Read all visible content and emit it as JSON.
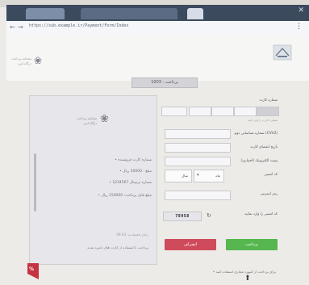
{
  "browser": {
    "url": "https://sub.example.ir/Payment/Form/Index"
  },
  "header": {
    "brand_line1": "سامانه پرداخت",
    "brand_line2": "درگاه امن"
  },
  "title": "پرداخت - 1003",
  "left_panel": {
    "logo_line1": "سامانه پرداخت",
    "logo_line2": "درگاه امن",
    "lines": [
      "• شماره کارت فروشنده",
      "• مبلغ : 50000 ریال",
      "• شماره ترمینال 1234567",
      "• مبلغ قابل پرداخت: 150000 ریال"
    ],
    "footer": "زمان باقیمانده: 09:43",
    "checkbox_label": "پرداخت با استفاده از کارت های ذخیره شده"
  },
  "form": {
    "card_label": "شماره کارت",
    "card_hint": "شماره کارت را وارد کنید",
    "cvv2_label": "شماره شناسایی دوم (CVV2)",
    "expiry_label": "تاریخ انقضای کارت",
    "expiry_month": "ماه",
    "expiry_year": "سال",
    "captcha_label": "کد امنیتی",
    "captcha_hint": "کد امنیتی را وارد نمایید",
    "pin_label": "رمز اینترنتی",
    "email_label": "پست الکترونیک (اختیاری)",
    "captcha_value": "78958"
  },
  "buttons": {
    "cancel": "انصراف",
    "pay": "پرداخت"
  },
  "bottom_note": "• برای پرداخت از کیبورد مجازی استفاده کنید",
  "colors": {
    "cancel": "#cf4a5b",
    "pay": "#56b64f",
    "accent": "#3d4f9a"
  }
}
